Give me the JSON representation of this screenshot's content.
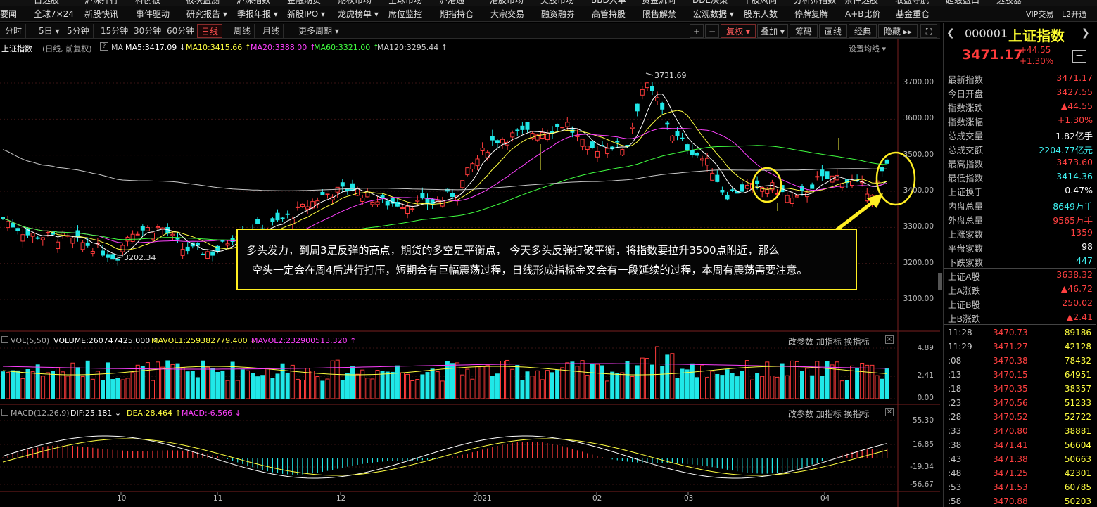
{
  "top_menu_row0": [
    "自选股",
    "沪深排行",
    "科创板",
    "板块监测",
    "沪深指数",
    "金融期货",
    "期权市场",
    "全球市场",
    "沪港通",
    "港股市场",
    "美股市场",
    "BBD大单",
    "资金流向",
    "DDE决策",
    "个股风向",
    "分析师指数",
    "条件选股",
    "收盘导航",
    "超级盘口",
    "选股器"
  ],
  "top_menu": [
    "要闻",
    "全球7×24",
    "新股快讯",
    "事件驱动",
    "研究报告 ▾",
    "季报年报 ▾",
    "新股IPO ▾",
    "龙虎榜单 ▾",
    "席位监控",
    "期指持仓",
    "大宗交易",
    "融资融券",
    "高管持股",
    "限售解禁",
    "宏观数据 ▾",
    "股东人数",
    "停牌复牌",
    "A+B比价",
    "基金重仓"
  ],
  "vip": {
    "vip_label": "VIP交易",
    "l2_label": "L2开通"
  },
  "periods": [
    "分时",
    "5日 ▾",
    "5分钟",
    "15分钟",
    "30分钟",
    "60分钟",
    "日线",
    "周线",
    "月线",
    "更多周期 ▾"
  ],
  "active_period": "日线",
  "toolbar_right": {
    "plus": "+",
    "minus": "−",
    "fuquan": "复权 ▾",
    "overlay": "叠加 ▾",
    "chouma": "筹码",
    "huaxian": "画线",
    "jingdian": "经典",
    "hide": "隐藏 ▸▸"
  },
  "chart_header": {
    "name": "上证指数",
    "mode": "(日线, 前复权)",
    "ma_label": "MA",
    "ma5": "MA5:3417.09 ↓",
    "ma10": "MA10:3415.66 ↑",
    "ma20": "MA20:3388.00 ↑",
    "ma60": "MA60:3321.00 ↑",
    "ma120": "MA120:3295.44 ↑",
    "settings": "设置均线 ▾"
  },
  "annotations": {
    "high": "3731.69",
    "low": "3202.34"
  },
  "yaxis_price": [
    "3700.00",
    "3600.00",
    "3500.00",
    "3400.00",
    "3300.00",
    "3200.00",
    "3100.00"
  ],
  "xaxis": [
    "10",
    "11",
    "12",
    "2021",
    "02",
    "03",
    "04"
  ],
  "vol_header": {
    "title": "VOL(5,50)",
    "volume": "VOLUME:260747425.000 ↑",
    "mavol1": "MAVOL1:259382779.400 ↓",
    "mavol2": "MAVOL2:232900513.320 ↑",
    "tools": "改参数  加指标  换指标"
  },
  "yaxis_vol": [
    "4.89",
    "2.41",
    "0.00"
  ],
  "macd_header": {
    "title": "MACD(12,26,9)",
    "dif": "DIF:25.181 ↓",
    "dea": "DEA:28.464 ↑",
    "macd": "MACD:-6.566 ↓",
    "tools": "改参数  加指标  换指标"
  },
  "yaxis_macd": [
    "55.30",
    "16.85",
    "-19.34",
    "-56.67"
  ],
  "annotation_box": {
    "line1": "多头发力，到周3是反弹的高点，期货的多空是平衡点， 今天多头反弹打破平衡，将指数要拉升3500点附近，那么",
    "line2": "空头一定会在周4后进行打压，短期会有巨幅震荡过程，日线形成指标金叉会有一段延续的过程，本周有震荡需要注意。"
  },
  "quote": {
    "code": "000001",
    "name": "上证指数",
    "price": "3471.17",
    "change": "+44.55",
    "change_pct": "+1.30%"
  },
  "stats": [
    {
      "k": "最新指数",
      "v": "3471.17",
      "c": "red"
    },
    {
      "k": "今日开盘",
      "v": "3427.55",
      "c": "red"
    },
    {
      "k": "指数涨跌",
      "v": "▲44.55",
      "c": "red"
    },
    {
      "k": "指数涨幅",
      "v": "+1.30%",
      "c": "red"
    },
    {
      "k": "总成交量",
      "v": "1.82亿手",
      "c": "white"
    },
    {
      "k": "总成交额",
      "v": "2204.77亿元",
      "c": "cyan"
    },
    {
      "k": "最高指数",
      "v": "3473.60",
      "c": "red"
    },
    {
      "k": "最低指数",
      "v": "3414.36",
      "c": "cyan"
    },
    {
      "k": "上证换手",
      "v": "0.47%",
      "c": "white"
    },
    {
      "k": "内盘总量",
      "v": "8649万手",
      "c": "cyan"
    },
    {
      "k": "外盘总量",
      "v": "9565万手",
      "c": "red"
    },
    {
      "k": "上涨家数",
      "v": "1359",
      "c": "red"
    },
    {
      "k": "平盘家数",
      "v": "98",
      "c": "white"
    },
    {
      "k": "下跌家数",
      "v": "447",
      "c": "cyan"
    },
    {
      "k": "上证A股",
      "v": "3638.32",
      "c": "red"
    },
    {
      "k": "上A涨跌",
      "v": "▲46.72",
      "c": "red"
    },
    {
      "k": "上证B股",
      "v": "250.02",
      "c": "red"
    },
    {
      "k": "上B涨跌",
      "v": "▲2.41",
      "c": "red"
    }
  ],
  "ticks": [
    {
      "t": "11:28",
      "p": "3470.73",
      "q": "89186"
    },
    {
      "t": "11:29",
      "p": "3471.27",
      "q": "42128"
    },
    {
      "t": ":08",
      "p": "3470.38",
      "q": "78432"
    },
    {
      "t": ":13",
      "p": "3470.15",
      "q": "64951"
    },
    {
      "t": ":18",
      "p": "3470.35",
      "q": "38357"
    },
    {
      "t": ":23",
      "p": "3470.56",
      "q": "51233"
    },
    {
      "t": ":28",
      "p": "3470.52",
      "q": "52722"
    },
    {
      "t": ":33",
      "p": "3470.80",
      "q": "38881"
    },
    {
      "t": ":38",
      "p": "3471.41",
      "q": "56604"
    },
    {
      "t": ":43",
      "p": "3471.38",
      "q": "50663"
    },
    {
      "t": ":48",
      "p": "3471.25",
      "q": "42301"
    },
    {
      "t": ":53",
      "p": "3471.53",
      "q": "60785"
    },
    {
      "t": ":58",
      "p": "3470.88",
      "q": "50203"
    }
  ],
  "colors": {
    "up": "#ff3b3b",
    "down": "#20e8e8",
    "ma5": "#ffffff",
    "ma10": "#ffff40",
    "ma20": "#ff40ff",
    "ma60": "#40ff40",
    "ma120": "#c8c8c8",
    "highlight": "#ffee22"
  }
}
